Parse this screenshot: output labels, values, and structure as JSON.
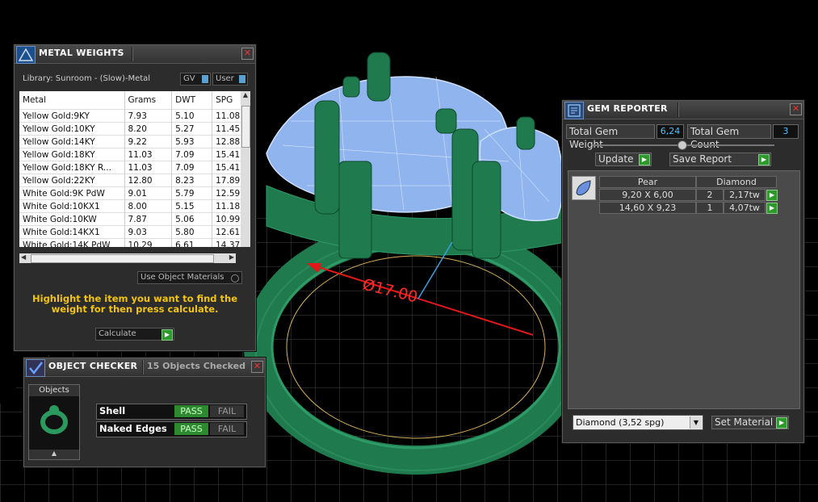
{
  "metal_weights": {
    "title": "METAL WEIGHTS",
    "library": "Library: Sunroom - (Slow)-Metal",
    "gv_label": "GV",
    "user_label": "User",
    "columns": [
      "Metal",
      "Grams",
      "DWT",
      "SPG"
    ],
    "rows": [
      [
        "Yellow Gold:9KY",
        "7.93",
        "5.10",
        "11.08"
      ],
      [
        "Yellow Gold:10KY",
        "8.20",
        "5.27",
        "11.45"
      ],
      [
        "Yellow Gold:14KY",
        "9.22",
        "5.93",
        "12.88"
      ],
      [
        "Yellow Gold:18KY",
        "11.03",
        "7.09",
        "15.41"
      ],
      [
        "Yellow Gold:18KY R...",
        "11.03",
        "7.09",
        "15.41"
      ],
      [
        "Yellow Gold:22KY",
        "12.80",
        "8.23",
        "17.89"
      ],
      [
        "White Gold:9K PdW",
        "9.01",
        "5.79",
        "12.59"
      ],
      [
        "White Gold:10KX1",
        "8.00",
        "5.15",
        "11.18"
      ],
      [
        "White Gold:10KW",
        "7.87",
        "5.06",
        "10.99"
      ],
      [
        "White Gold:14KX1",
        "9.03",
        "5.80",
        "12.61"
      ],
      [
        "White Gold:14K PdW",
        "10.29",
        "6.61",
        "14.37"
      ]
    ],
    "use_object_materials": "Use Object Materials",
    "hint": "Highlight the item you want to find the weight for then press calculate.",
    "calculate_label": "Calculate"
  },
  "object_checker": {
    "title": "OBJECT CHECKER",
    "status": "15  Objects Checked",
    "objects_label": "Objects",
    "checks": [
      {
        "name": "Shell",
        "pass": "PASS",
        "fail": "FAIL"
      },
      {
        "name": "Naked Edges",
        "pass": "PASS",
        "fail": "FAIL"
      }
    ]
  },
  "gem_reporter": {
    "title": "GEM REPORTER",
    "total_weight_label": "Total Gem Weight",
    "total_weight_value": "6,24",
    "total_count_label": "Total Gem Count",
    "total_count_value": "3",
    "update_label": "Update",
    "save_report_label": "Save Report",
    "shape_header": "Pear",
    "material_header": "Diamond",
    "rows": [
      {
        "size": "9,20 X 6,00",
        "count": "2",
        "weight": "2,17tw"
      },
      {
        "size": "14,60 X 9,23",
        "count": "1",
        "weight": "4,07tw"
      }
    ],
    "material_select": "Diamond   (3,52 spg)",
    "set_material_label": "Set Material"
  },
  "viewport": {
    "dimension_label": "Ø17.00"
  }
}
